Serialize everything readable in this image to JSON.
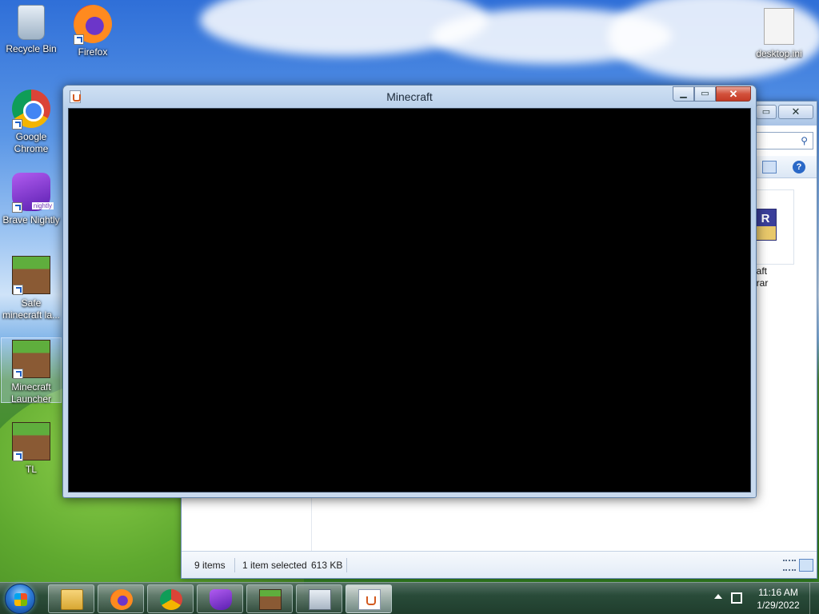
{
  "desktop": {
    "icons": [
      {
        "label": "Recycle Bin"
      },
      {
        "label": "Firefox"
      },
      {
        "label": "desktop.ini"
      },
      {
        "label": "Google Chrome"
      },
      {
        "label": "Brave Nightly"
      },
      {
        "label": "Safe minecraft la..."
      },
      {
        "label": "Minecraft Launcher"
      },
      {
        "label": "TL"
      }
    ],
    "brave_badge": "nightly"
  },
  "explorer": {
    "file_name_line1": "ncraft",
    "file_name_line2": "ed.rar",
    "rar_badge": "R",
    "status": {
      "items": "9 items",
      "selected": "1 item selected",
      "size": "613 KB"
    }
  },
  "minecraft_window": {
    "title": "Minecraft"
  },
  "taskbar": {
    "clock_time": "11:16 AM",
    "clock_date": "1/29/2022",
    "apps": [
      "file-explorer",
      "firefox",
      "chrome",
      "brave-nightly",
      "minecraft-launcher",
      "performance-monitor",
      "java"
    ]
  }
}
